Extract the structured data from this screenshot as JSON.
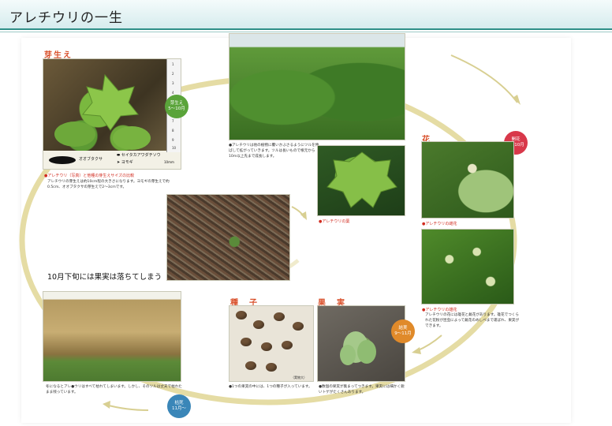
{
  "header": {
    "title": "アレチウリの一生"
  },
  "stages": {
    "germination": {
      "label": "芽生え",
      "badge_line1": "芽生え",
      "badge_line2": "5～10月",
      "legend": [
        "オオブタクサ",
        "セイタカアワダチソウ",
        "ヨモギ"
      ],
      "scale": "10mm",
      "ruler": [
        "1",
        "2",
        "3",
        "4",
        "5",
        "6",
        "7",
        "8",
        "9",
        "10"
      ],
      "caption_title": "●アレチウリ（写真）と他種の芽生えサイズの比較",
      "caption": "アレチウリの芽生えは約10cm程の大きさになります。ヨモギの芽生えで約0.5cm、オオブタクサの芽生えで2～3cmです。"
    },
    "growth": {
      "caption": "●アレチウリは他の植物に覆いかぶさるようにツルを伸ばして拡がっていきます。ツルは長いもので根元から10m以上先まで成長します。"
    },
    "leaf": {
      "caption": "●アレチウリの葉"
    },
    "flower": {
      "label": "花",
      "badge_line1": "開花",
      "badge_line2": "8～10月",
      "female_caption": "●アレチウリの雌花",
      "male_caption_title": "●アレチウリの雄花",
      "male_caption": "アレチウリの花には雄花と雌花があります。雄花でつくられた花粉が昆虫によって雌花のめしべまで運ばれ、果実ができます。"
    },
    "fallen": {
      "overlay": "10月下旬には果実は落ちてしまう"
    },
    "seed": {
      "label": "種　子",
      "caption": "●1つの果実の中には、1つの種子が入っています。",
      "credit": "（実物大）"
    },
    "fruit": {
      "label": "果　実",
      "badge_line1": "結実",
      "badge_line2": "9～11月",
      "caption": "●数個の果実が集まってつきます。果実には細かく鋭いトゲがたくさんあります。"
    },
    "death": {
      "badge_line1": "枯死",
      "badge_line2": "11月～",
      "caption": "冬になるとアレ●ウリはすべて枯れてしまいます。しかし、そのツルは丈夫で枯れたまま残っています。"
    }
  },
  "colors": {
    "accent": "#2f8f88",
    "cycle_ring": "#e2d89a",
    "badge_green": "#5aa43a",
    "badge_red": "#d8384a",
    "badge_orange": "#e08a2a",
    "badge_blue": "#3a86b8",
    "stage_label": "#d9512c"
  }
}
